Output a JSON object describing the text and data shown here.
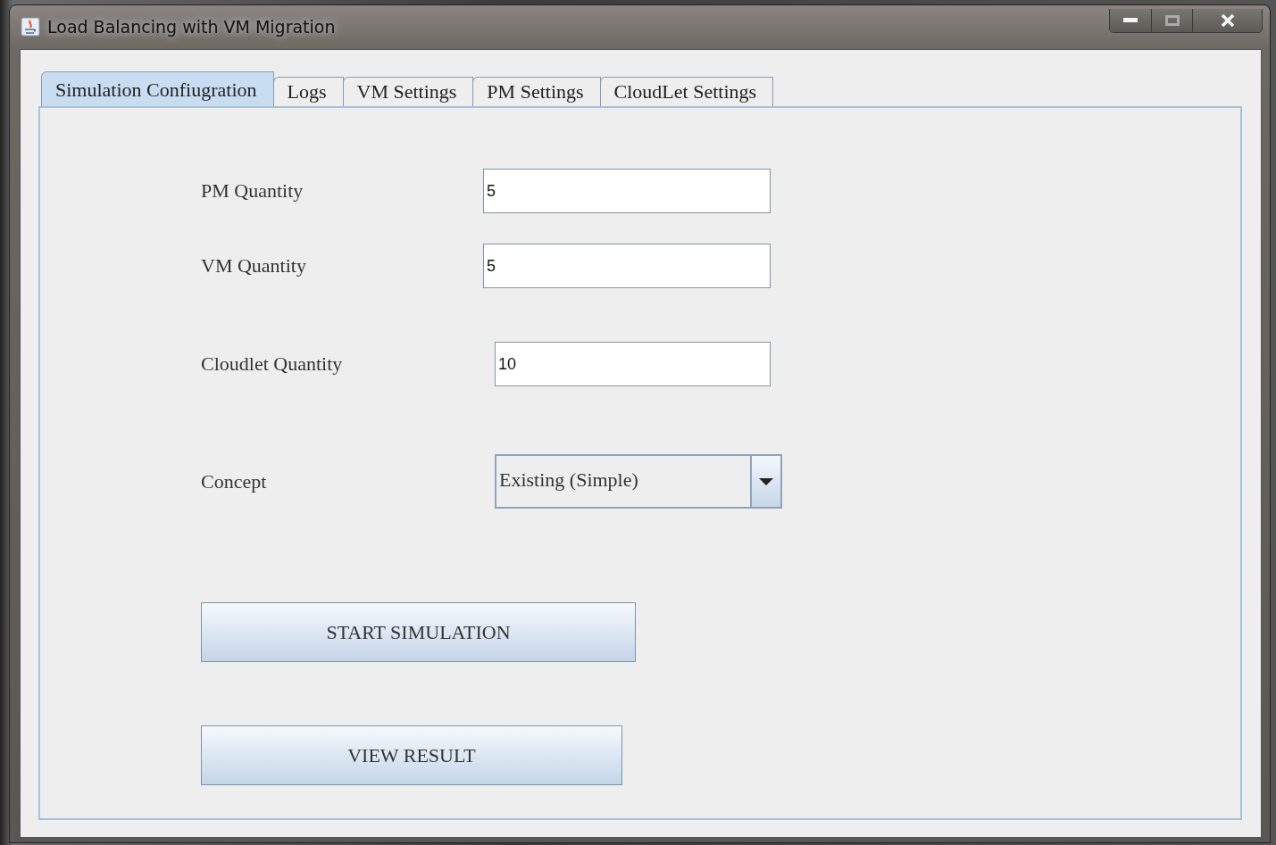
{
  "window": {
    "title": "Load Balancing with VM Migration"
  },
  "tabs": [
    {
      "label": "Simulation Confiugration",
      "selected": true
    },
    {
      "label": "Logs",
      "selected": false
    },
    {
      "label": "VM Settings",
      "selected": false
    },
    {
      "label": "PM Settings",
      "selected": false
    },
    {
      "label": "CloudLet Settings",
      "selected": false
    }
  ],
  "form": {
    "fields": [
      {
        "kind": "text",
        "label": "PM Quantity",
        "value": "5"
      },
      {
        "kind": "text",
        "label": "VM Quantity",
        "value": "5"
      },
      {
        "kind": "text",
        "label": "Cloudlet Quantity",
        "value": "10"
      },
      {
        "kind": "combo",
        "label": "Concept",
        "value": "Existing (Simple)"
      }
    ],
    "buttons": [
      "START SIMULATION",
      "VIEW RESULT"
    ]
  }
}
